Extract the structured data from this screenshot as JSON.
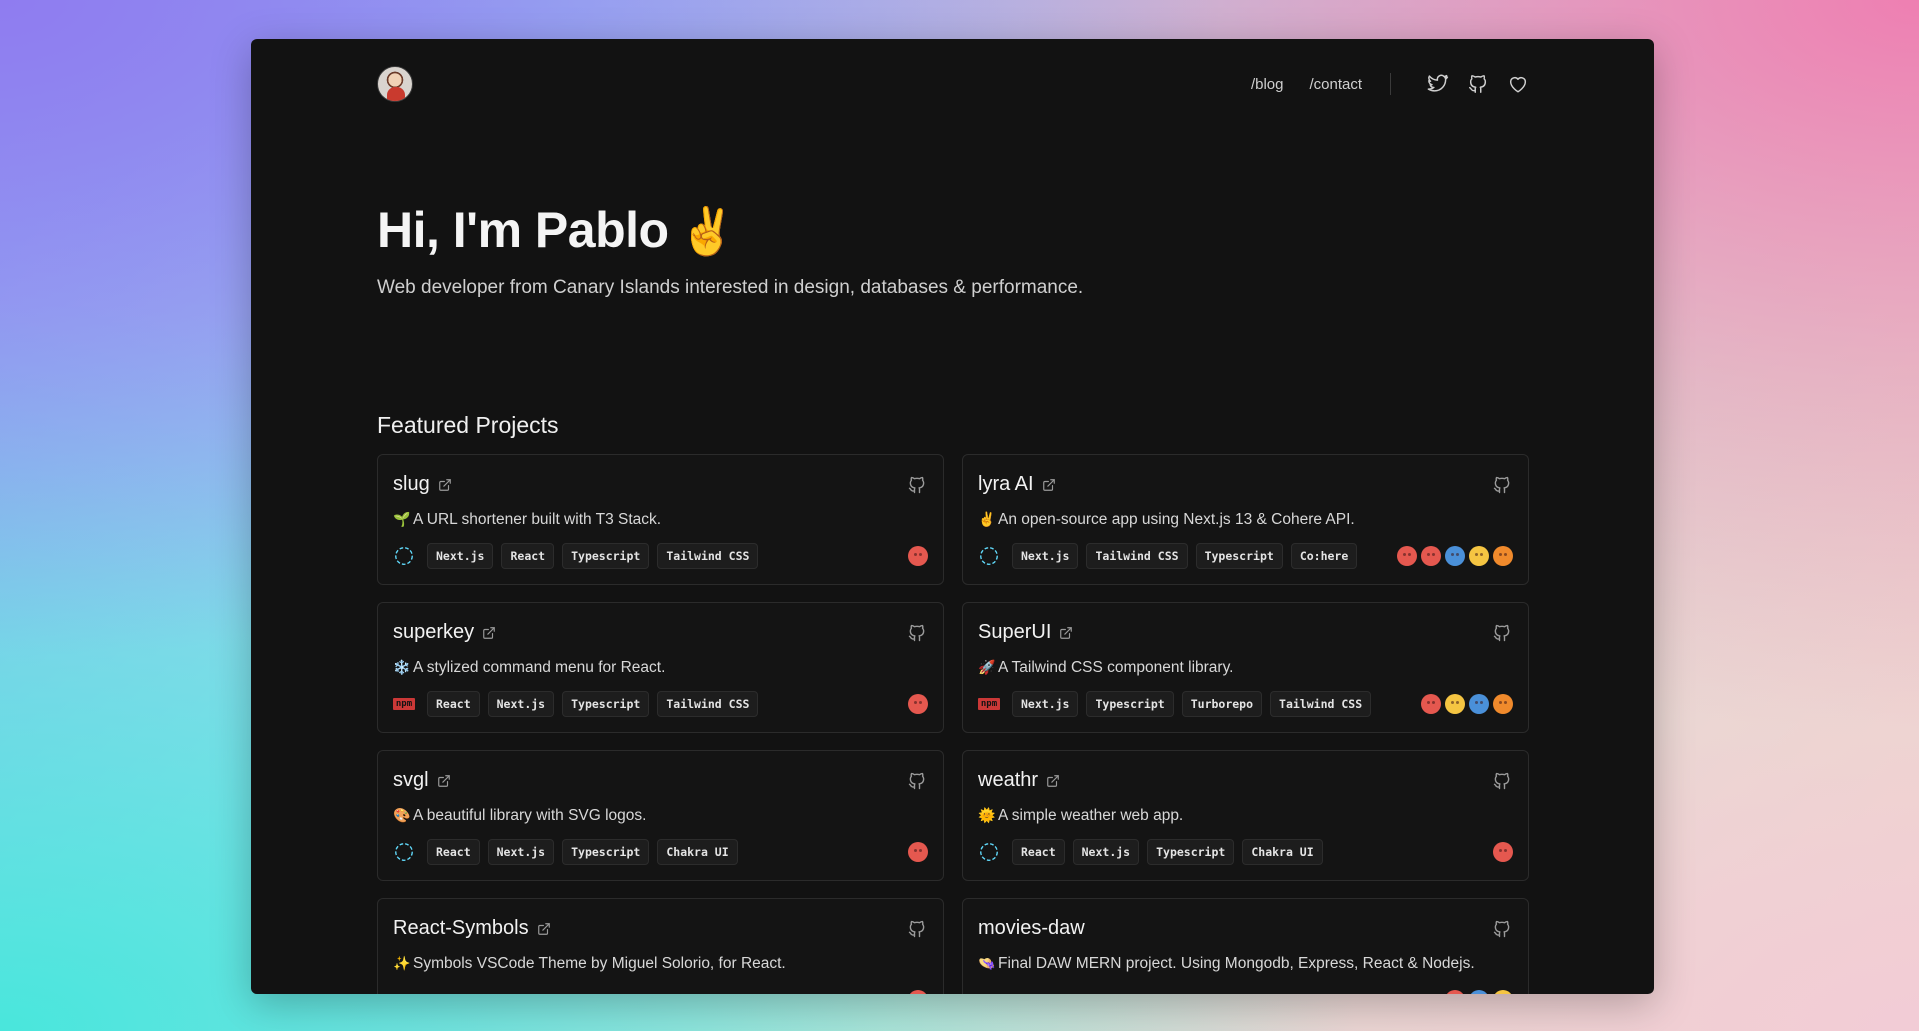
{
  "header": {
    "nav": [
      {
        "label": "/blog"
      },
      {
        "label": "/contact"
      }
    ],
    "icons": [
      "twitter-icon",
      "github-icon",
      "heart-icon"
    ]
  },
  "hero": {
    "title": "Hi, I'm Pablo",
    "emoji": "✌️",
    "subtitle": "Web developer from Canary Islands interested in design, databases & performance."
  },
  "section": {
    "title": "Featured Projects"
  },
  "colors": {
    "background": "#121212",
    "card_border": "#2b2b2b",
    "react_blue": "#61dafb",
    "npm_red": "#cb3837",
    "face_red": "#e5584f",
    "face_yellow": "#f5c542",
    "face_blue": "#4a90d9",
    "face_orange": "#f08a2c"
  },
  "projects": [
    {
      "name": "slug",
      "emoji": "🌱",
      "description": "A URL shortener built with T3 Stack.",
      "kind": "react-icon",
      "tags": [
        "Next.js",
        "React",
        "Typescript",
        "Tailwind CSS"
      ],
      "faces": [
        "#e5584f"
      ]
    },
    {
      "name": "lyra AI",
      "emoji": "✌️",
      "description": "An open-source app using Next.js 13 & Cohere API.",
      "kind": "react-icon",
      "tags": [
        "Next.js",
        "Tailwind CSS",
        "Typescript",
        "Co:here"
      ],
      "faces": [
        "#e5584f",
        "#e5584f",
        "#4a90d9",
        "#f5c542",
        "#f08a2c"
      ]
    },
    {
      "name": "superkey",
      "emoji": "❄️",
      "description": "A stylized command menu for React.",
      "kind": "npm-icon",
      "tags": [
        "React",
        "Next.js",
        "Typescript",
        "Tailwind CSS"
      ],
      "faces": [
        "#e5584f"
      ]
    },
    {
      "name": "SuperUI",
      "emoji": "🚀",
      "description": "A Tailwind CSS component library.",
      "kind": "npm-icon",
      "tags": [
        "Next.js",
        "Typescript",
        "Turborepo",
        "Tailwind CSS"
      ],
      "faces": [
        "#e5584f",
        "#f5c542",
        "#4a90d9",
        "#f08a2c"
      ]
    },
    {
      "name": "svgl",
      "emoji": "🎨",
      "description": "A beautiful library with SVG logos.",
      "kind": "react-icon",
      "tags": [
        "React",
        "Next.js",
        "Typescript",
        "Chakra UI"
      ],
      "faces": [
        "#e5584f"
      ]
    },
    {
      "name": "weathr",
      "emoji": "🌞",
      "description": "A simple weather web app.",
      "kind": "react-icon",
      "tags": [
        "React",
        "Next.js",
        "Typescript",
        "Chakra UI"
      ],
      "faces": [
        "#e5584f"
      ]
    },
    {
      "name": "React-Symbols",
      "emoji": "✨",
      "description": "Symbols VSCode Theme by Miguel Solorio, for React.",
      "kind": "react-icon",
      "tags": [],
      "faces": [
        "#e5584f"
      ],
      "external": true
    },
    {
      "name": "movies-daw",
      "emoji": "👒",
      "description": "Final DAW MERN project. Using Mongodb, Express, React & Nodejs.",
      "kind": "react-icon",
      "tags": [],
      "faces": [
        "#e5584f",
        "#4a90d9",
        "#f5c542"
      ],
      "external": false
    }
  ]
}
